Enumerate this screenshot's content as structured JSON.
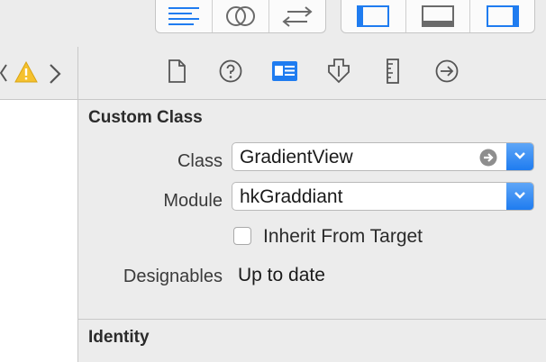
{
  "toolbar": {
    "editor_buttons": [
      {
        "icon": "standard-editor-icon",
        "active": true
      },
      {
        "icon": "assistant-editor-icon",
        "active": false
      },
      {
        "icon": "version-editor-icon",
        "active": false
      }
    ],
    "view_buttons": [
      {
        "icon": "left-panel-icon",
        "active": true
      },
      {
        "icon": "bottom-panel-icon",
        "active": false
      },
      {
        "icon": "right-panel-icon",
        "active": true
      }
    ],
    "accent_color": "#1f7cf0"
  },
  "navigator": {
    "icons": [
      "chevron-left-icon",
      "warning-icon",
      "chevron-right-icon"
    ]
  },
  "inspector_tabs": [
    {
      "name": "file-inspector",
      "icon": "file-icon",
      "active": false
    },
    {
      "name": "quick-help",
      "icon": "help-icon",
      "active": false
    },
    {
      "name": "identity-inspector",
      "icon": "identity-icon",
      "active": true
    },
    {
      "name": "attributes-inspector",
      "icon": "attributes-icon",
      "active": false
    },
    {
      "name": "size-inspector",
      "icon": "ruler-icon",
      "active": false
    },
    {
      "name": "connections-inspector",
      "icon": "connections-icon",
      "active": false
    }
  ],
  "custom_class": {
    "title": "Custom Class",
    "class_label": "Class",
    "class_value": "GradientView",
    "module_label": "Module",
    "module_value": "hkGraddiant",
    "inherit_label": "Inherit From Target",
    "inherit_checked": false,
    "designables_label": "Designables",
    "designables_value": "Up to date"
  },
  "identity": {
    "title": "Identity"
  }
}
